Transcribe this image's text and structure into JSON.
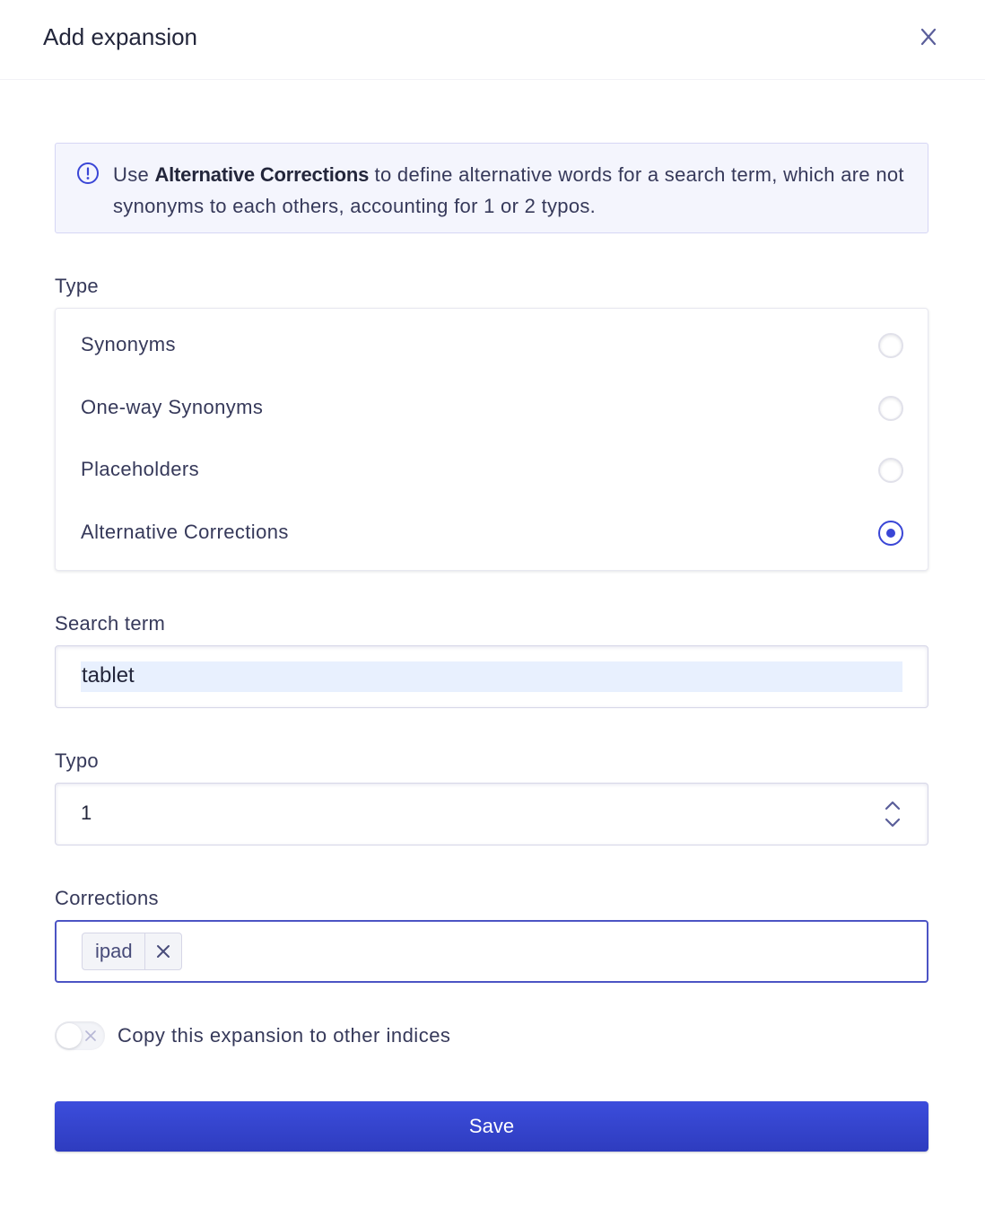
{
  "dialog": {
    "title": "Add expansion",
    "close_icon": "close-icon"
  },
  "info": {
    "icon": "info-circle-icon",
    "prefix": "Use ",
    "highlight": "Alternative Corrections",
    "suffix": " to define alternative words for a search term, which are not synonyms to each others, accounting for 1 or 2 typos."
  },
  "type": {
    "label": "Type",
    "options": [
      {
        "label": "Synonyms",
        "checked": false
      },
      {
        "label": "One-way Synonyms",
        "checked": false
      },
      {
        "label": "Placeholders",
        "checked": false
      },
      {
        "label": "Alternative Corrections",
        "checked": true
      }
    ]
  },
  "search_term": {
    "label": "Search term",
    "value": "tablet"
  },
  "typo": {
    "label": "Typo",
    "value": "1",
    "stepper_icon": "chevron-up-down-icon"
  },
  "corrections": {
    "label": "Corrections",
    "tags": [
      {
        "label": "ipad"
      }
    ]
  },
  "copy_toggle": {
    "label": "Copy this expansion to other indices",
    "on": false
  },
  "save_label": "Save",
  "colors": {
    "accent": "#3a46d6",
    "info_bg": "#f4f5fd",
    "autofill_bg": "#e8f0fe"
  }
}
